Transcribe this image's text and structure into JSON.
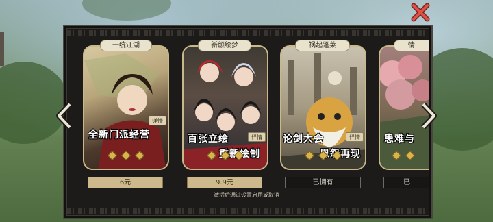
{
  "cards": [
    {
      "tab": "一统江湖",
      "slogan_line1": "全新门派经营",
      "slogan_line2": "",
      "detail": "详情",
      "price": "6元",
      "status": "buy"
    },
    {
      "tab": "新颜绘梦",
      "slogan_line1": "百张立绘",
      "slogan_line2": "重新绘制",
      "detail": "详情",
      "price": "9.9元",
      "status": "buy"
    },
    {
      "tab": "祸起蓬莱",
      "slogan_line1": "论剑大会",
      "slogan_line2": "恩怨再现",
      "detail": "详情",
      "price": "已拥有",
      "status": "owned"
    },
    {
      "tab": "情",
      "slogan_line1": "患难与",
      "slogan_line2": "",
      "detail": "",
      "price": "已",
      "status": "owned"
    }
  ],
  "note": "激活后通过设置启用或取消",
  "colors": {
    "close": "#e0514a",
    "gold": "#d9b44a",
    "panel": "#1d1b19"
  },
  "icons": {
    "close": "close-x-icon",
    "prev": "chevron-left-icon",
    "next": "chevron-right-icon"
  }
}
